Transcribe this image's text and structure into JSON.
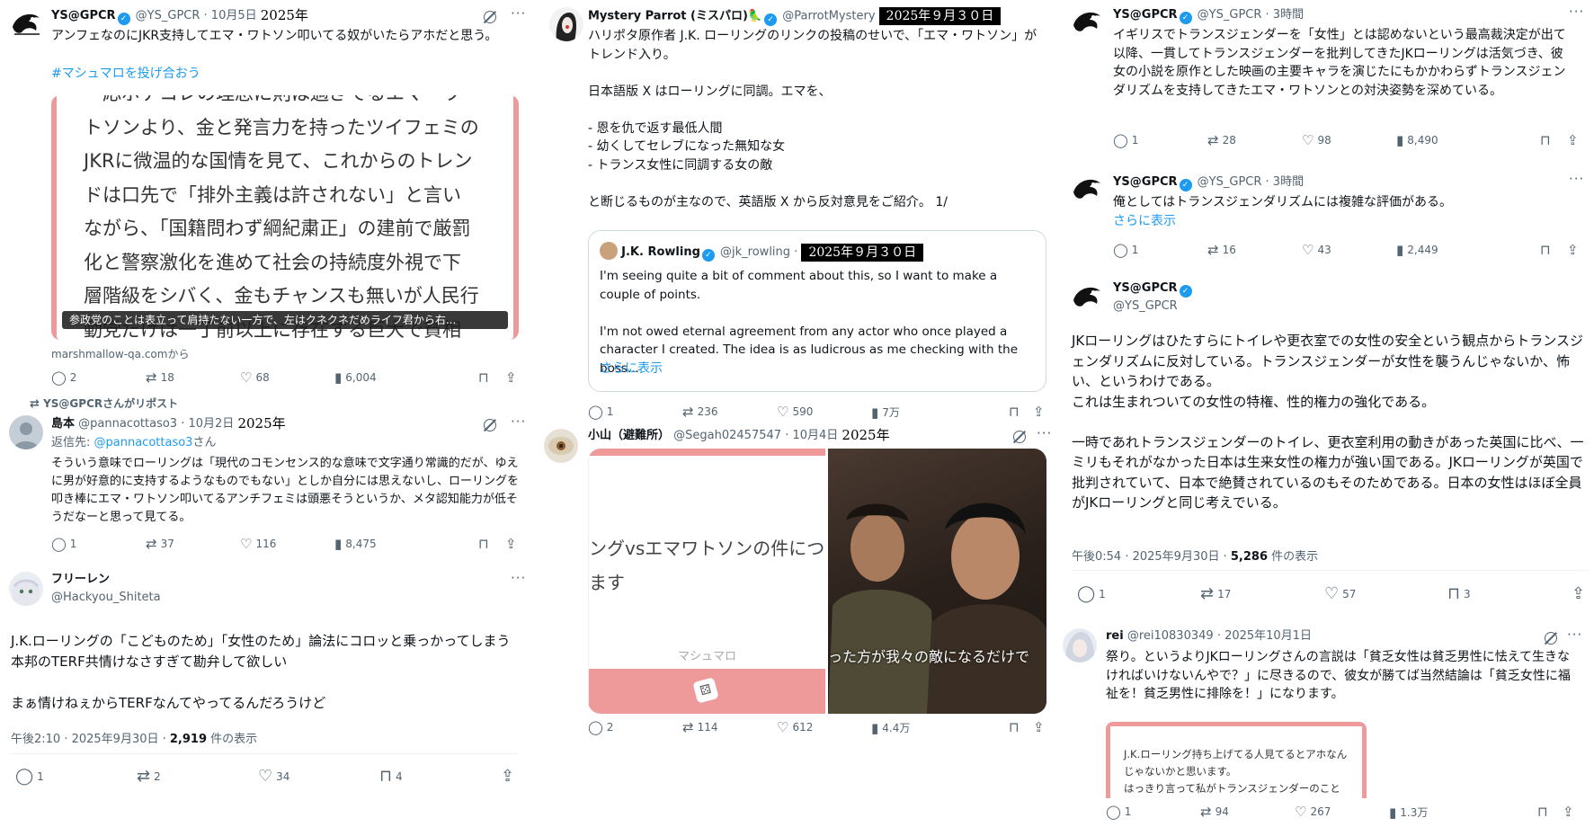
{
  "col1": {
    "t1": {
      "name": "YS@GPCR",
      "handle": "@YS_GPCR",
      "date": "· 10月5日",
      "year_overlay": "2025年",
      "text": "アンフェなのにJKR支持してエマ・ワトソン叩いてる奴がいたらアホだと思う。",
      "hashtag": "#マシュマロを投げ合おう",
      "marshmallow_text": "一応ポテコレの理念に則は過ぎてるエマ・ワトソンより、金と発言力を持ったツイフェミのJKRに微温的な国情を見て、これからのトレンドは口先で「排外主義は許されない」と言いながら、「国籍問わず綱紀粛正」の建前で厳罰化と警察激化を進めて社会の持続度外視で下層階級をシバく、金もチャンスも無いが人民行動党だけは一丁前以上に存在する巨大で貧相なシンガポ",
      "caption": "参政党のことは表立って肩持たない一方で、左はクネクネだめライフ君から右...",
      "source": "marshmallow-qa.comから",
      "replies": "2",
      "retweets": "18",
      "likes": "68",
      "views": "6,004"
    },
    "repost_label": "YS@GPCRさんがリポスト",
    "t2": {
      "name": "島本",
      "handle": "@pannacottaso3",
      "date": "· 10月2日",
      "year_overlay": "2025年",
      "reply_prefix": "返信先: ",
      "reply_to": "@pannacottaso3",
      "reply_suffix": "さん",
      "text": "そういう意味でローリングは「現代のコモンセンス的な意味で文字通り常識的だが、ゆえに男が好意的に支持するようなものでもない」としか自分には思えないし、ローリングを叩き棒にエマ・ワトソン叩いてるアンチフェミは頭悪そうというか、メタ認知能力が低そうだなーと思って見てる。",
      "replies": "1",
      "retweets": "37",
      "likes": "116",
      "views": "8,475"
    },
    "t3": {
      "name": "フリーレン",
      "handle": "@Hackyou_Shiteta",
      "text": "J.K.ローリングの「こどものため」「女性のため」論法にコロッと乗っかってしまう本邦のTERF共情けなさすぎて勘弁して欲しい\n\nまぁ情けねぇからTERFなんてやってるんだろうけど",
      "time": "午後2:10 · 2025年9月30日 · ",
      "views": "2,919",
      "views_suffix": " 件の表示",
      "replies": "1",
      "retweets": "2",
      "likes": "34",
      "bookmarks": "4"
    }
  },
  "col2": {
    "t1": {
      "name": "Mystery Parrot (ミスパロ)",
      "handle": "@ParrotMystery",
      "date_overlay": "2025年９月３０日",
      "text": "ハリポタ原作者 J.K. ローリングのリンクの投稿のせいで、「エマ・ワトソン」がトレンド入り。\n\n日本語版 X はローリングに同調。エマを、\n\n- 恩を仇で返す最低人間\n- 幼くしてセレブになった無知な女\n- トランス女性に同調する女の敵\n\nと断じるものが主なので、英語版 X から反対意見をご紹介。 1/",
      "quote": {
        "name": "J.K. Rowling",
        "handle": "@jk_rowling",
        "date_overlay": "2025年９月３０日",
        "text": "I'm seeing quite a bit of comment about this, so I want to make a couple of points.\n\nI'm not owed eternal agreement from any actor who once played a character I created. The idea is as ludicrous as me checking with the boss...",
        "show_more": "さらに表示"
      },
      "replies": "1",
      "retweets": "236",
      "likes": "590",
      "views": "7万"
    },
    "t2": {
      "name": "小山（避難所）",
      "handle": "@Segah02457547",
      "date": "· 10月4日",
      "year_overlay": "2025年",
      "marsh_text": "ングvsエマワトソンの件につ",
      "marsh_text2": "ます",
      "marsh_label": "マシュマロ",
      "subtitle": "った方が我々の敵になるだけで",
      "replies": "2",
      "retweets": "114",
      "likes": "612",
      "views": "4.4万"
    }
  },
  "col3": {
    "t1": {
      "name": "YS@GPCR",
      "handle": "@YS_GPCR",
      "date": "· 3時間",
      "text": "イギリスでトランスジェンダーを「女性」とは認めないという最高裁決定が出て以降、一貫してトランスジェンダーを批判してきたJKローリングは活気づき、彼女の小説を原作とした映画の主要キャラを演じたにもかかわらずトランスジェンダリズムを支持してきたエマ・ワトソンとの対決姿勢を深めている。",
      "replies": "1",
      "retweets": "28",
      "likes": "98",
      "views": "8,490"
    },
    "t2": {
      "name": "YS@GPCR",
      "handle": "@YS_GPCR",
      "date": "· 3時間",
      "text": "俺としてはトランスジェンダリズムには複雑な評価がある。",
      "show_more": "さらに表示",
      "replies": "1",
      "retweets": "16",
      "likes": "43",
      "views": "2,449"
    },
    "t3": {
      "name": "YS@GPCR",
      "handle": "@YS_GPCR",
      "text": "JKローリングはひたすらにトイレや更衣室での女性の安全という観点からトランスジェンダリズムに反対している。トランスジェンダーが女性を襲うんじゃないか、怖い、というわけである。\nこれは生まれついての女性の特権、性的権力の強化である。\n\n一時であれトランスジェンダーのトイレ、更衣室利用の動きがあった英国に比べ、一ミリもそれがなかった日本は生来女性の権力が強い国である。JKローリングが英国で批判されていて、日本で絶賛されているのもそのためである。日本の女性はほぼ全員がJKローリングと同じ考えでいる。",
      "time": "午後0:54 · 2025年9月30日 · ",
      "views": "5,286",
      "views_suffix": " 件の表示",
      "replies": "1",
      "retweets": "17",
      "likes": "57",
      "bookmarks": "3"
    },
    "t4": {
      "name": "rei",
      "handle": "@rei10830349",
      "date": "· 2025年10月1日",
      "text": "祭り。というよりJKローリングさんの言説は「貧乏女性は貧乏男性に怯えて生きなければいけないんやで？」に尽きるので、彼女が勝てば当然結論は「貧乏女性に福祉を！貧乏男性に排除を！」になります。",
      "marsh_text": "J.K.ローリング持ち上げてる人見てるとアホなんじゃないかと思います。\nはっきり言って私がトランスジェンダーのこと",
      "replies": "1",
      "retweets": "94",
      "likes": "267",
      "views": "1.3万"
    }
  },
  "icons": {
    "reply": "reply-icon",
    "retweet": "retweet-icon",
    "like": "heart-icon",
    "views": "views-icon",
    "bookmark": "bookmark-icon",
    "share": "share-icon",
    "more": "more-icon",
    "grok": "grok-icon",
    "verified": "verified-badge-icon"
  },
  "colors": {
    "accent": "#1d9bf0",
    "marshmallow_pink": "#ef9a9a",
    "muted": "#536471"
  }
}
